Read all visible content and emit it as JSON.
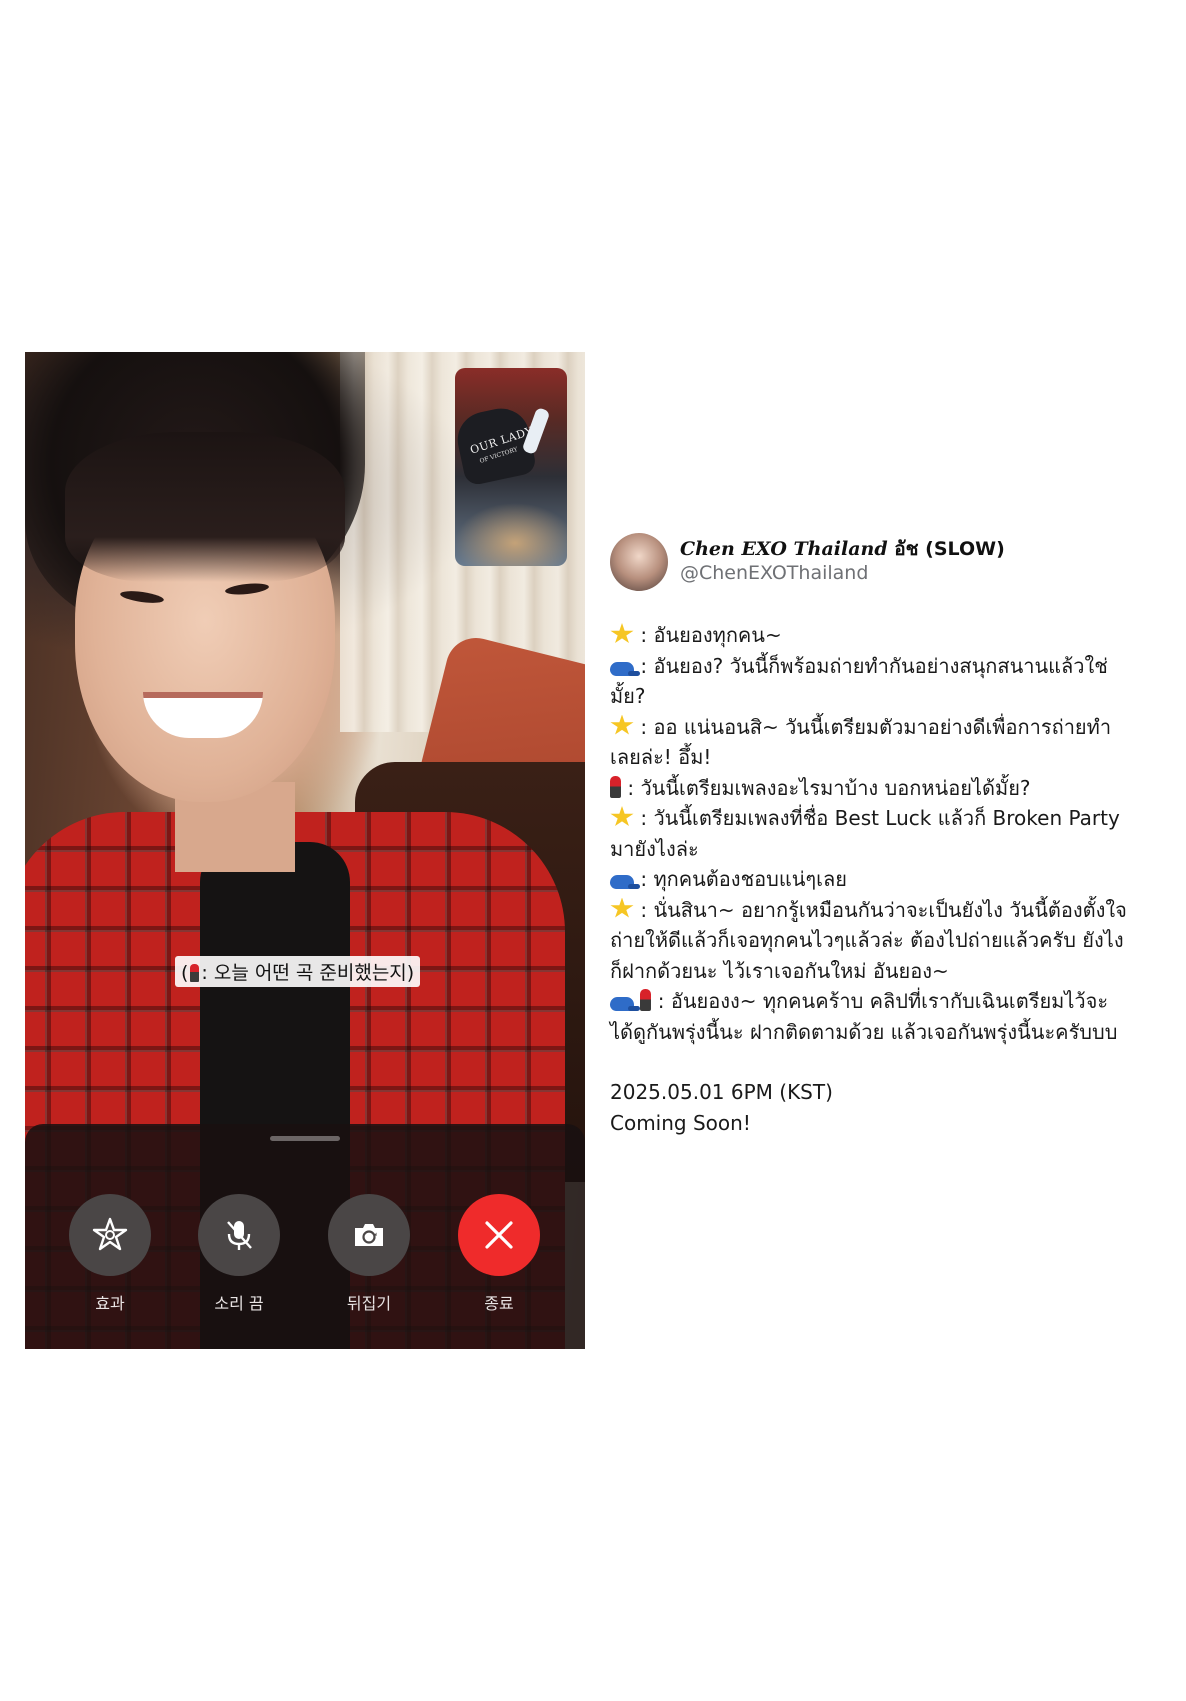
{
  "call": {
    "caption_prefix": "(",
    "caption_text": ": 오늘 어떤 곡 준비했는지)",
    "pip_cap_text": "OUR LADY",
    "pip_cap_sub": "OF VICTORY",
    "controls": [
      {
        "label": "효과",
        "icon": "effects-icon"
      },
      {
        "label": "소리 끔",
        "icon": "mic-off-icon"
      },
      {
        "label": "뒤집기",
        "icon": "flip-camera-icon"
      },
      {
        "label": "종료",
        "icon": "end-call-icon"
      }
    ],
    "end_color": "#ef2b2b"
  },
  "tweet": {
    "display_name": "Chen EXO Thailand",
    "display_name_suffix": "อัช (SLOW)",
    "handle": "@ChenEXOThailand",
    "lines": [
      {
        "emojis": [
          "star-icon"
        ],
        "text": " : อันยองทุกคน~"
      },
      {
        "emojis": [
          "cap-icon"
        ],
        "text": " : อันยอง? วันนี้ก็พร้อมถ่ายทำกันอย่างสนุกสนานแล้วใช่มั้ย?"
      },
      {
        "emojis": [
          "star-icon"
        ],
        "text": " : ออ แน่นอนสิ~ วันนี้เตรียมตัวมาอย่างดีเพื่อการถ่ายทำเลยล่ะ! อึ้ม!"
      },
      {
        "emojis": [
          "lipstick-icon"
        ],
        "text": " : วันนี้เตรียมเพลงอะไรมาบ้าง บอกหน่อยได้มั้ย?"
      },
      {
        "emojis": [
          "star-icon"
        ],
        "text": " : วันนี้เตรียมเพลงที่ชื่อ Best Luck แล้วก็ Broken Party มายังไงล่ะ"
      },
      {
        "emojis": [
          "cap-icon"
        ],
        "text": " : ทุกคนต้องชอบแน่ๆเลย"
      },
      {
        "emojis": [
          "star-icon"
        ],
        "text": " : นั่นสินา~ อยากรู้เหมือนกันว่าจะเป็นยังไง วันนี้ต้องตั้งใจถ่ายให้ดีแล้วก็เจอทุกคนไวๆแล้วล่ะ ต้องไปถ่ายแล้วครับ ยังไงก็ฝากด้วยนะ ไว้เราเจอกันใหม่ อันยอง~"
      },
      {
        "emojis": [
          "cap-icon",
          "lipstick-icon"
        ],
        "text": "  : อันยองง~ ทุกคนคร้าบ คลิปที่เรากับเฉินเตรียมไว้จะได้ดูกันพรุ่งนี้นะ ฝากติดตามด้วย แล้วเจอกันพรุ่งนี้นะครับบบ"
      }
    ],
    "date_line": "2025.05.01 6PM (KST)",
    "coming_soon": "Coming Soon!"
  }
}
